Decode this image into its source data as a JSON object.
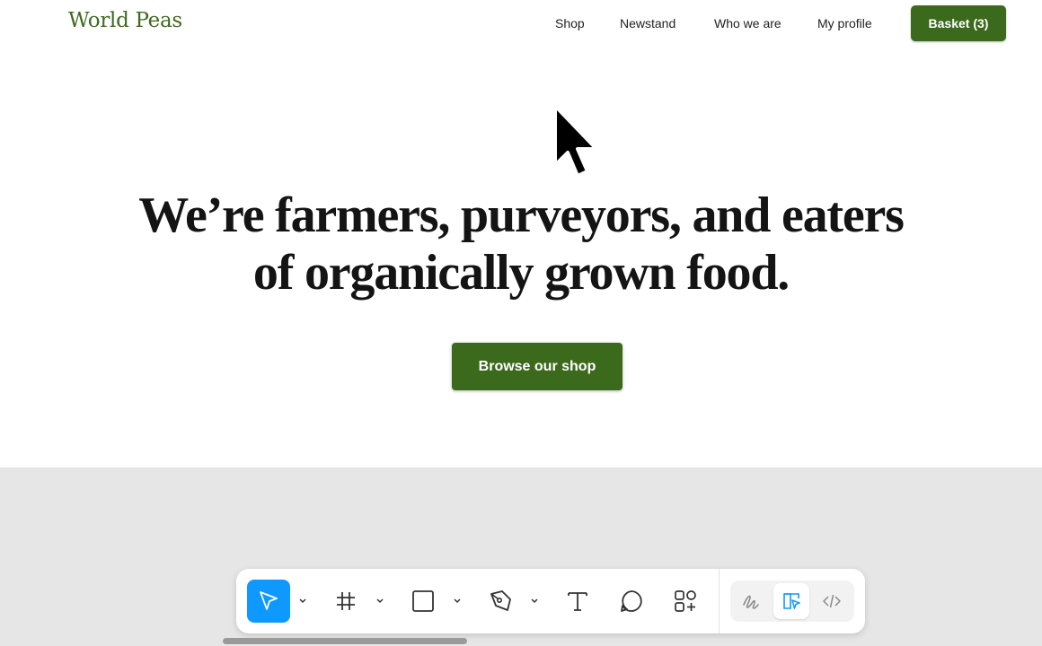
{
  "site": {
    "brand": "World Peas",
    "nav": [
      "Shop",
      "Newstand",
      "Who we are",
      "My profile"
    ],
    "basket_label": "Basket (3)",
    "hero_line_1": "We’re farmers, purveyors, and eaters",
    "hero_line_2": "of organically grown food.",
    "browse_label": "Browse our shop",
    "accent_color": "#3c6a1c"
  },
  "toolbar": {
    "tools": [
      "move-tool",
      "frame-tool",
      "rectangle-tool",
      "pen-tool",
      "text-tool",
      "comment-tool",
      "assets-tool"
    ],
    "active_tool": "move-tool",
    "modes": [
      "draw-mode",
      "design-mode",
      "dev-mode"
    ],
    "active_mode": "design-mode",
    "active_color": "#0d99ff"
  }
}
